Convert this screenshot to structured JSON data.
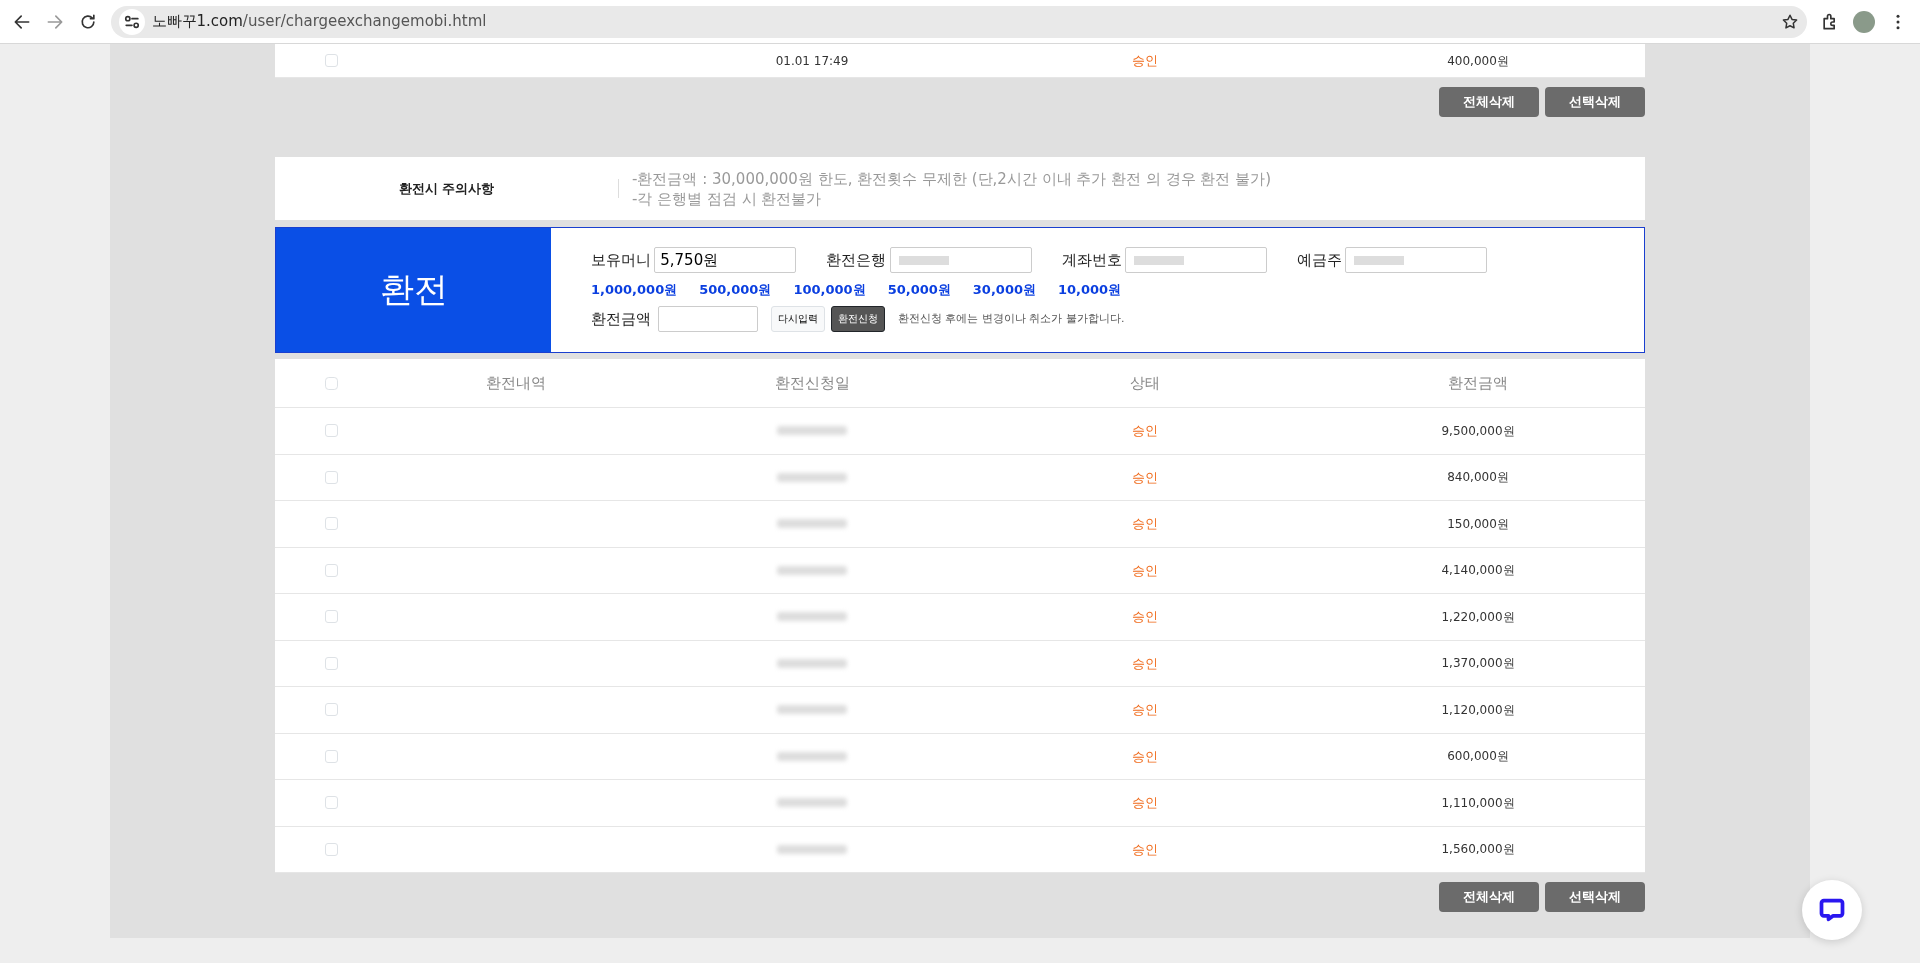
{
  "browser": {
    "url_host": "노빠꾸1.com",
    "url_path": "/user/chargeexchangemobi.html"
  },
  "top_row": {
    "checked": false,
    "date": "01.01 17:49",
    "blurred": false,
    "status": "승인",
    "amount": "400,000원"
  },
  "top_buttons": [
    "전체삭제",
    "선택삭제"
  ],
  "notice": {
    "title": "환전시 주의사항",
    "lines": [
      "-환전금액 : 30,000,000원 한도, 환전횟수 무제한 (단,2시간 이내 추가 환전 의 경우 환전 불가)",
      "-각 은행별 점검 시 환전불가"
    ]
  },
  "exchange": {
    "title": "환전",
    "fields": [
      {
        "label": "보유머니",
        "value": "5,750원",
        "blurred": false
      },
      {
        "label": "환전은행",
        "blurred": true
      },
      {
        "label": "계좌번호",
        "blurred": true
      },
      {
        "label": "예금주",
        "blurred": true
      }
    ],
    "quick_amounts": [
      "1,000,000원",
      "500,000원",
      "100,000원",
      "50,000원",
      "30,000원",
      "10,000원"
    ],
    "amount_label": "환전금액",
    "reset_button": "다시입력",
    "submit_button": "환전신청",
    "note": "환전신청 후에는 변경이나 취소가 불가합니다."
  },
  "table": {
    "header_checked": false,
    "columns": [
      "환전내역",
      "환전신청일",
      "상태",
      "환전금액"
    ],
    "rows": [
      {
        "checked": false,
        "blurred": true,
        "status": "승인",
        "amount": "9,500,000원"
      },
      {
        "checked": false,
        "blurred": true,
        "status": "승인",
        "amount": "840,000원"
      },
      {
        "checked": false,
        "blurred": true,
        "status": "승인",
        "amount": "150,000원"
      },
      {
        "checked": false,
        "blurred": true,
        "status": "승인",
        "amount": "4,140,000원"
      },
      {
        "checked": false,
        "blurred": true,
        "status": "승인",
        "amount": "1,220,000원"
      },
      {
        "checked": false,
        "blurred": true,
        "status": "승인",
        "amount": "1,370,000원"
      },
      {
        "checked": false,
        "blurred": true,
        "status": "승인",
        "amount": "1,120,000원"
      },
      {
        "checked": false,
        "blurred": true,
        "status": "승인",
        "amount": "600,000원"
      },
      {
        "checked": false,
        "blurred": true,
        "status": "승인",
        "amount": "1,110,000원"
      },
      {
        "checked": false,
        "blurred": true,
        "status": "승인",
        "amount": "1,560,000원"
      }
    ]
  },
  "bottom_buttons": [
    "전체삭제",
    "선택삭제"
  ]
}
